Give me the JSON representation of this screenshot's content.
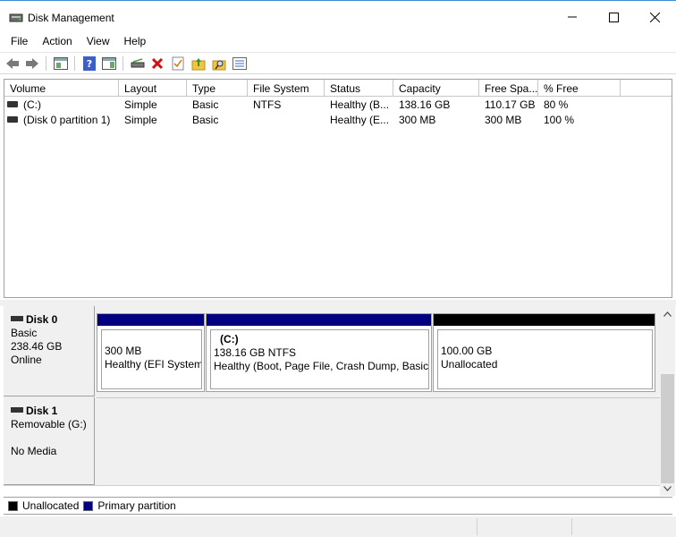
{
  "window": {
    "title": "Disk Management",
    "controls": {
      "minimize": "minimize-icon",
      "maximize": "maximize-icon",
      "close": "close-icon"
    }
  },
  "menu": {
    "items": [
      {
        "label": "File"
      },
      {
        "label": "Action"
      },
      {
        "label": "View"
      },
      {
        "label": "Help"
      }
    ]
  },
  "toolbar": {
    "icons": [
      "back-arrow-icon",
      "forward-arrow-icon",
      "properties-pane-icon",
      "help-icon",
      "console-pane-icon",
      "connect-drive-icon",
      "delete-icon",
      "check-icon",
      "folder-up-icon",
      "search-folder-icon",
      "properties-list-icon"
    ]
  },
  "volume_list": {
    "columns": [
      "Volume",
      "Layout",
      "Type",
      "File System",
      "Status",
      "Capacity",
      "Free Spa...",
      "% Free"
    ],
    "rows": [
      {
        "volume": "(C:)",
        "layout": "Simple",
        "type": "Basic",
        "filesystem": "NTFS",
        "status": "Healthy (B...",
        "capacity": "138.16 GB",
        "free": "110.17 GB",
        "pct": "80 %"
      },
      {
        "volume": "(Disk 0 partition 1)",
        "layout": "Simple",
        "type": "Basic",
        "filesystem": "",
        "status": "Healthy (E...",
        "capacity": "300 MB",
        "free": "300 MB",
        "pct": "100 %"
      }
    ]
  },
  "disks": [
    {
      "name": "Disk 0",
      "type": "Basic",
      "size": "238.46 GB",
      "state": "Online",
      "partitions": [
        {
          "title": "",
          "size": "300 MB",
          "status": "Healthy (EFI System",
          "color": "#000080"
        },
        {
          "title": "(C:)",
          "size": "138.16 GB NTFS",
          "status": "Healthy (Boot, Page File, Crash Dump, Basic D",
          "color": "#000080"
        },
        {
          "title": "",
          "size": "100.00 GB",
          "status": "Unallocated",
          "color": "#000000"
        }
      ]
    },
    {
      "name": "Disk 1",
      "type": "Removable (G:)",
      "state": "No Media"
    }
  ],
  "legend": [
    {
      "label": "Unallocated",
      "color": "#000000"
    },
    {
      "label": "Primary partition",
      "color": "#000080"
    }
  ],
  "colors": {
    "primary": "#000080",
    "unallocated": "#000000",
    "window_border": "#3c8bd6"
  }
}
